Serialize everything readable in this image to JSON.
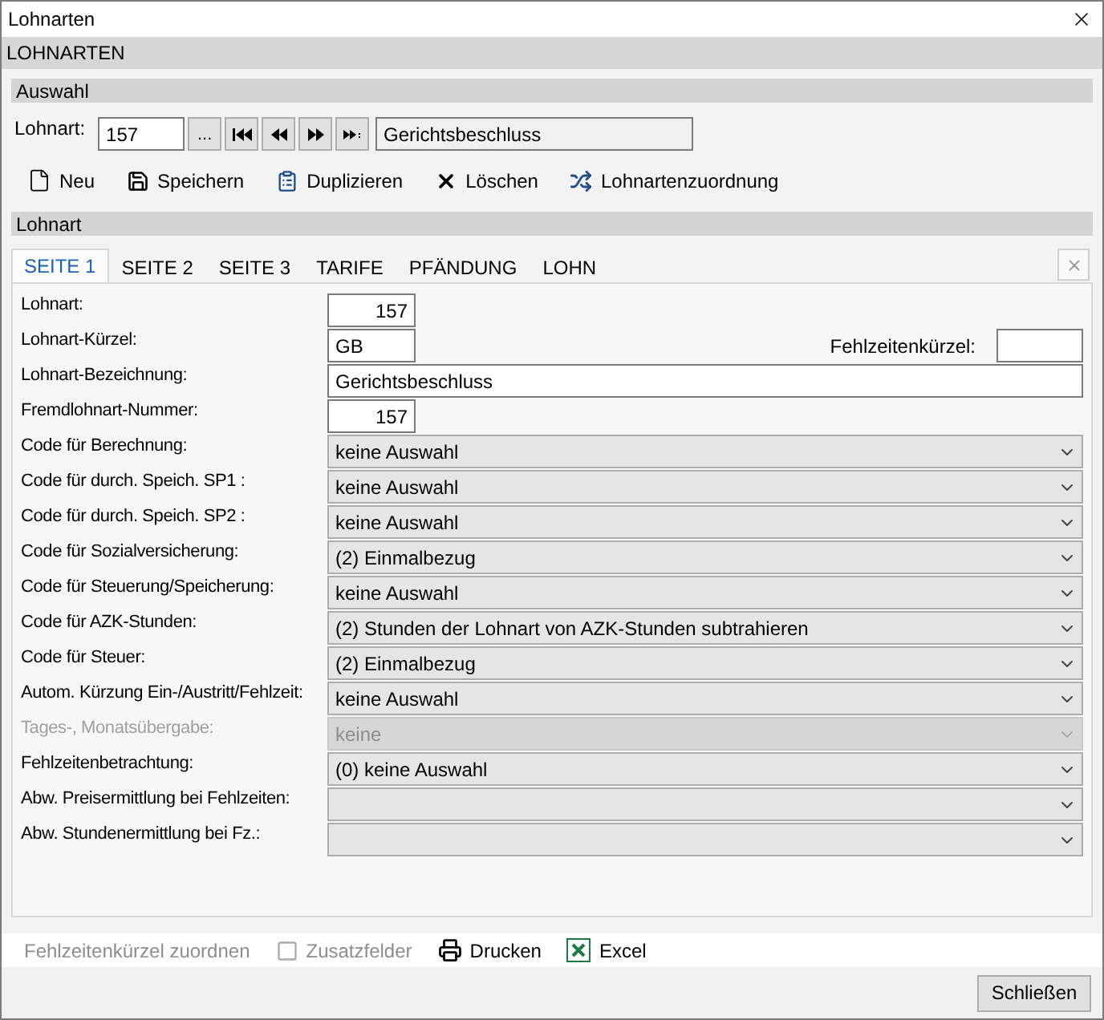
{
  "window": {
    "title": "Lohnarten"
  },
  "header": "LOHNARTEN",
  "auswahl": {
    "title": "Auswahl",
    "label": "Lohnart:",
    "value": "157",
    "browse": "...",
    "name": "Gerichtsbeschluss"
  },
  "toolbar": [
    {
      "kind": "new",
      "label": "Neu"
    },
    {
      "kind": "save",
      "label": "Speichern"
    },
    {
      "kind": "duplicate",
      "label": "Duplizieren"
    },
    {
      "kind": "delete",
      "label": "Löschen"
    },
    {
      "kind": "shuffle",
      "label": "Lohnartenzuordnung"
    }
  ],
  "section": "Lohnart",
  "tabs": [
    {
      "label": "SEITE 1",
      "selected": true
    },
    {
      "label": "SEITE 2",
      "selected": false
    },
    {
      "label": "SEITE 3",
      "selected": false
    },
    {
      "label": "TARIFE",
      "selected": false
    },
    {
      "label": "PFÄNDUNG",
      "selected": false
    },
    {
      "label": "LOHN",
      "selected": false
    }
  ],
  "form": [
    {
      "kind": "number",
      "label": "Lohnart:",
      "value": "157"
    },
    {
      "kind": "short",
      "label": "Lohnart-Kürzel:",
      "value": "GB",
      "extra_label": "Fehlzeitenkürzel:"
    },
    {
      "kind": "wide",
      "label": "Lohnart-Bezeichnung:",
      "value": "Gerichtsbeschluss"
    },
    {
      "kind": "number",
      "label": "Fremdlohnart-Nummer:",
      "value": "157"
    },
    {
      "kind": "select",
      "label": "Code für Berechnung:",
      "value": "keine Auswahl",
      "disabled": false
    },
    {
      "kind": "select",
      "label": "Code für durch. Speich. SP1 :",
      "value": "keine Auswahl",
      "disabled": false
    },
    {
      "kind": "select",
      "label": "Code für durch. Speich. SP2 :",
      "value": "keine Auswahl",
      "disabled": false
    },
    {
      "kind": "select",
      "label": "Code für Sozialversicherung:",
      "value": "(2) Einmalbezug",
      "disabled": false
    },
    {
      "kind": "select",
      "label": "Code für Steuerung/Speicherung:",
      "value": "keine Auswahl",
      "disabled": false
    },
    {
      "kind": "select",
      "label": "Code für AZK-Stunden:",
      "value": "(2) Stunden der Lohnart von AZK-Stunden subtrahieren",
      "disabled": false
    },
    {
      "kind": "select",
      "label": "Code für Steuer:",
      "value": "(2) Einmalbezug",
      "disabled": false
    },
    {
      "kind": "select",
      "label": "Autom. Kürzung Ein-/Austritt/Fehlzeit:",
      "value": "keine Auswahl",
      "disabled": false
    },
    {
      "kind": "select",
      "label": "Tages-, Monatsübergabe:",
      "value": "keine",
      "disabled": true
    },
    {
      "kind": "select",
      "label": "Fehlzeitenbetrachtung:",
      "value": "(0) keine Auswahl",
      "disabled": false
    },
    {
      "kind": "select",
      "label": "Abw. Preisermittlung bei Fehlzeiten:",
      "disabled": false
    },
    {
      "kind": "select",
      "label": "Abw. Stundenermittlung bei Fz.:",
      "disabled": false
    }
  ],
  "bottom_toolbar": [
    {
      "kind": "text",
      "label": "Fehlzeitenkürzel zuordnen",
      "disabled": true
    },
    {
      "kind": "fields",
      "label": "Zusatzfelder",
      "disabled": true
    },
    {
      "kind": "print",
      "label": "Drucken",
      "disabled": false
    },
    {
      "kind": "excel",
      "label": "Excel",
      "disabled": false
    }
  ],
  "close_button": "Schließen"
}
